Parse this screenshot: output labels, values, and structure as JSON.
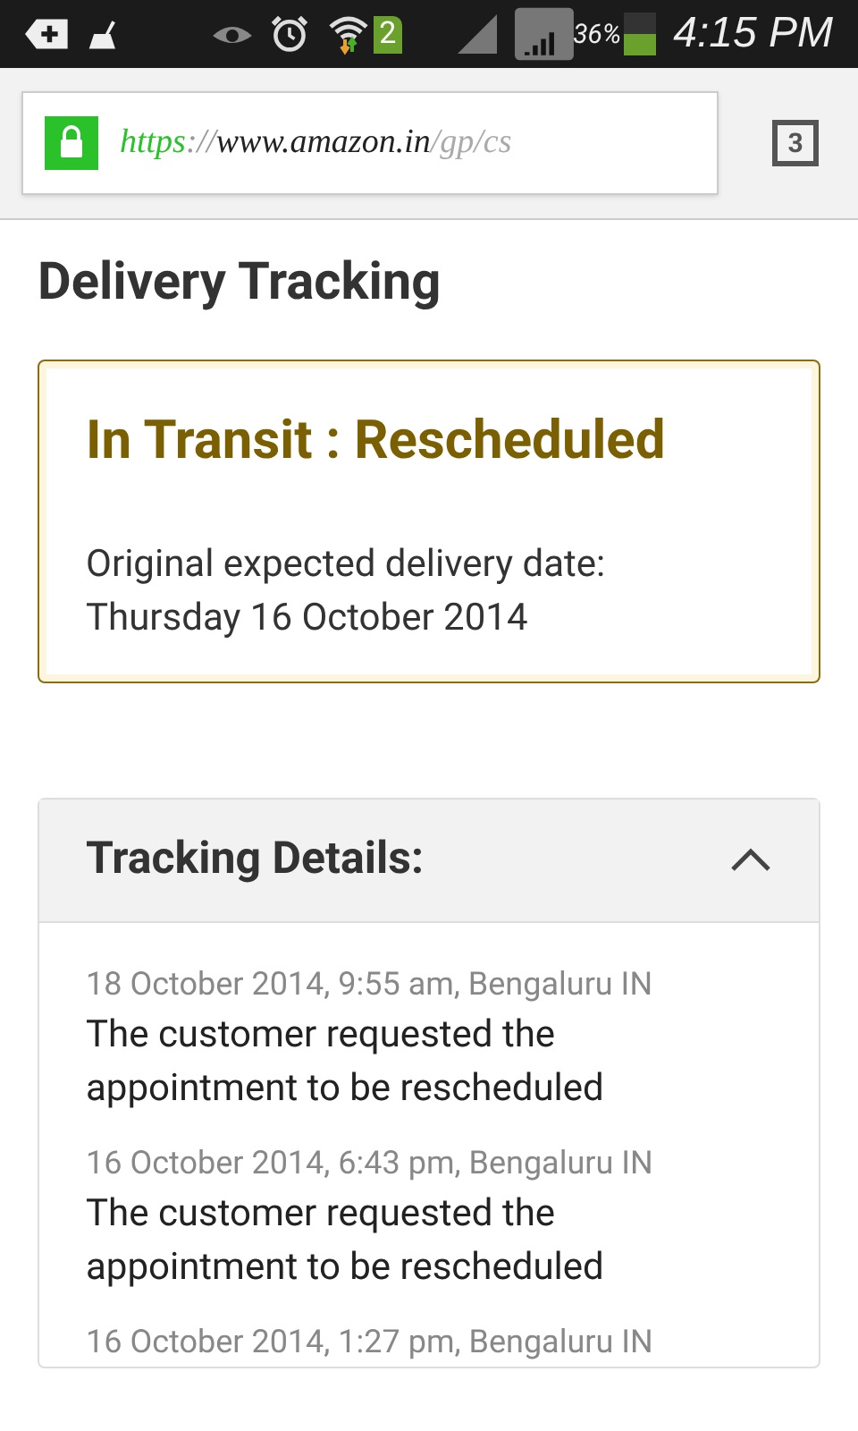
{
  "status_bar": {
    "sim_badge": "2",
    "battery": "36%",
    "time": "4:15 PM"
  },
  "browser": {
    "url": {
      "scheme": "https",
      "separator": "://",
      "host": "www.amazon.in",
      "path": "/gp/cs"
    },
    "secure": true,
    "tab_count": "3"
  },
  "page": {
    "title": "Delivery Tracking",
    "status_card": {
      "status": "In Transit : Rescheduled",
      "label": "Original expected delivery date:",
      "date": "Thursday 16 October 2014"
    },
    "tracking": {
      "title": "Tracking Details:",
      "expanded": true,
      "events": [
        {
          "meta": "18 October 2014, 9:55 am, Bengaluru IN",
          "description": "The customer requested the appointment to be rescheduled"
        },
        {
          "meta": "16 October 2014, 6:43 pm, Bengaluru IN",
          "description": "The customer requested the appointment to be rescheduled"
        },
        {
          "meta": "16 October 2014, 1:27 pm, Bengaluru IN"
        }
      ]
    }
  }
}
